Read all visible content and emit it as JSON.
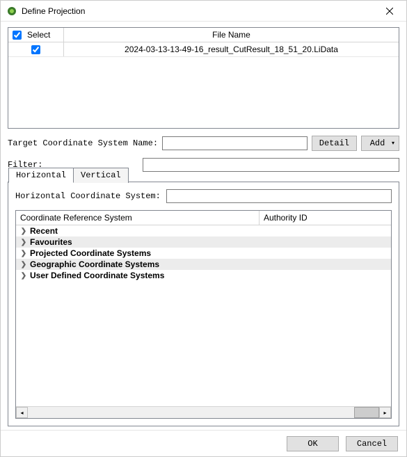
{
  "window": {
    "title": "Define Projection"
  },
  "fileTable": {
    "headers": {
      "select": "Select",
      "fileName": "File Name"
    },
    "rows": [
      {
        "selected": true,
        "fileName": "2024-03-13-13-49-16_result_CutResult_18_51_20.LiData"
      }
    ]
  },
  "targetCoord": {
    "label": "Target Coordinate System Name:",
    "value": "",
    "detailBtn": "Detail",
    "addBtn": "Add"
  },
  "filter": {
    "label": "Filter:",
    "value": ""
  },
  "tabs": {
    "horizontal": "Horizontal",
    "vertical": "Vertical"
  },
  "horizontalPanel": {
    "label": "Horizontal Coordinate System:",
    "value": "",
    "crsHeaders": {
      "crs": "Coordinate Reference System",
      "auth": "Authority ID"
    },
    "tree": [
      {
        "label": "Recent",
        "alt": false
      },
      {
        "label": "Favourites",
        "alt": true
      },
      {
        "label": "Projected Coordinate Systems",
        "alt": false
      },
      {
        "label": "Geographic Coordinate Systems",
        "alt": true
      },
      {
        "label": "User Defined Coordinate Systems",
        "alt": false
      }
    ]
  },
  "footer": {
    "ok": "OK",
    "cancel": "Cancel"
  }
}
